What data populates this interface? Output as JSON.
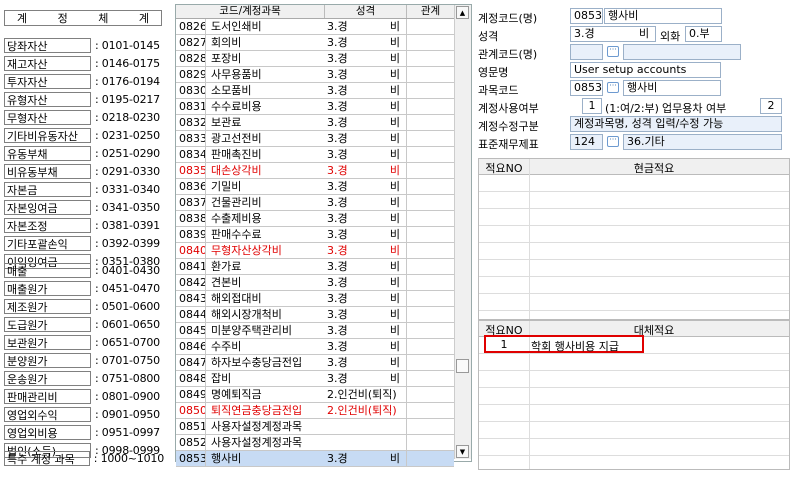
{
  "groups": {
    "header": {
      "col1": "계",
      "col2": "정",
      "col3": "체",
      "col4": "계"
    },
    "items": [
      {
        "name": "당좌자산",
        "range": ": 0101-0145"
      },
      {
        "name": "재고자산",
        "range": ": 0146-0175"
      },
      {
        "name": "투자자산",
        "range": ": 0176-0194"
      },
      {
        "name": "유형자산",
        "range": ": 0195-0217"
      },
      {
        "name": "무형자산",
        "range": ": 0218-0230"
      },
      {
        "name": "기타비유동자산",
        "range": ": 0231-0250"
      },
      {
        "name": "유동부채",
        "range": ": 0251-0290"
      },
      {
        "name": "비유동부채",
        "range": ": 0291-0330"
      },
      {
        "name": "자본금",
        "range": ": 0331-0340"
      },
      {
        "name": "자본잉여금",
        "range": ": 0341-0350"
      },
      {
        "name": "자본조정",
        "range": ": 0381-0391"
      },
      {
        "name": "기타포괄손익",
        "range": ": 0392-0399"
      },
      {
        "name": "이익잉여금",
        "range": ": 0351-0380"
      },
      {
        "name": "매출",
        "range": ": 0401-0430"
      },
      {
        "name": "매출원가",
        "range": ": 0451-0470"
      },
      {
        "name": "제조원가",
        "range": ": 0501-0600"
      },
      {
        "name": "도급원가",
        "range": ": 0601-0650"
      },
      {
        "name": "보관원가",
        "range": ": 0651-0700"
      },
      {
        "name": "분양원가",
        "range": ": 0701-0750"
      },
      {
        "name": "운송원가",
        "range": ": 0751-0800"
      },
      {
        "name": "판매관리비",
        "range": ": 0801-0900"
      },
      {
        "name": "영업외수익",
        "range": ": 0901-0950"
      },
      {
        "name": "영업외비용",
        "range": ": 0951-0997"
      },
      {
        "name": "법인(소득)",
        "range": ": 0998-0999"
      },
      {
        "name": "특수 계정 과목",
        "range": ": 1000~1010"
      }
    ]
  },
  "account_grid": {
    "headers": {
      "code_name": "코드/계정과목",
      "type": "성격",
      "relation": "관계"
    },
    "rows": [
      {
        "code": "0826",
        "name": "도서인쇄비",
        "type": "3.경",
        "type2": "비",
        "red": false,
        "selected": false
      },
      {
        "code": "0827",
        "name": "회의비",
        "type": "3.경",
        "type2": "비",
        "red": false,
        "selected": false
      },
      {
        "code": "0828",
        "name": "포장비",
        "type": "3.경",
        "type2": "비",
        "red": false,
        "selected": false
      },
      {
        "code": "0829",
        "name": "사무용품비",
        "type": "3.경",
        "type2": "비",
        "red": false,
        "selected": false
      },
      {
        "code": "0830",
        "name": "소모품비",
        "type": "3.경",
        "type2": "비",
        "red": false,
        "selected": false
      },
      {
        "code": "0831",
        "name": "수수료비용",
        "type": "3.경",
        "type2": "비",
        "red": false,
        "selected": false
      },
      {
        "code": "0832",
        "name": "보관료",
        "type": "3.경",
        "type2": "비",
        "red": false,
        "selected": false
      },
      {
        "code": "0833",
        "name": "광고선전비",
        "type": "3.경",
        "type2": "비",
        "red": false,
        "selected": false
      },
      {
        "code": "0834",
        "name": "판매촉진비",
        "type": "3.경",
        "type2": "비",
        "red": false,
        "selected": false
      },
      {
        "code": "0835",
        "name": "대손상각비",
        "type": "3.경",
        "type2": "비",
        "red": true,
        "selected": false
      },
      {
        "code": "0836",
        "name": "기밀비",
        "type": "3.경",
        "type2": "비",
        "red": false,
        "selected": false
      },
      {
        "code": "0837",
        "name": "건물관리비",
        "type": "3.경",
        "type2": "비",
        "red": false,
        "selected": false
      },
      {
        "code": "0838",
        "name": "수출제비용",
        "type": "3.경",
        "type2": "비",
        "red": false,
        "selected": false
      },
      {
        "code": "0839",
        "name": "판매수수료",
        "type": "3.경",
        "type2": "비",
        "red": false,
        "selected": false
      },
      {
        "code": "0840",
        "name": "무형자산상각비",
        "type": "3.경",
        "type2": "비",
        "red": true,
        "selected": false
      },
      {
        "code": "0841",
        "name": "환가료",
        "type": "3.경",
        "type2": "비",
        "red": false,
        "selected": false
      },
      {
        "code": "0842",
        "name": "견본비",
        "type": "3.경",
        "type2": "비",
        "red": false,
        "selected": false
      },
      {
        "code": "0843",
        "name": "해외접대비",
        "type": "3.경",
        "type2": "비",
        "red": false,
        "selected": false
      },
      {
        "code": "0844",
        "name": "해외시장개척비",
        "type": "3.경",
        "type2": "비",
        "red": false,
        "selected": false
      },
      {
        "code": "0845",
        "name": "미분양주택관리비",
        "type": "3.경",
        "type2": "비",
        "red": false,
        "selected": false
      },
      {
        "code": "0846",
        "name": "수주비",
        "type": "3.경",
        "type2": "비",
        "red": false,
        "selected": false
      },
      {
        "code": "0847",
        "name": "하자보수충당금전입",
        "type": "3.경",
        "type2": "비",
        "red": false,
        "selected": false
      },
      {
        "code": "0848",
        "name": "잡비",
        "type": "3.경",
        "type2": "비",
        "red": false,
        "selected": false
      },
      {
        "code": "0849",
        "name": "명예퇴직금",
        "type": "2.인건비(퇴직)",
        "type2": "",
        "red": false,
        "selected": false
      },
      {
        "code": "0850",
        "name": "퇴직연금충당금전입",
        "type": "2.인건비(퇴직)",
        "type2": "",
        "red": true,
        "selected": false
      },
      {
        "code": "0851",
        "name": "사용자설정계정과목",
        "type": "",
        "type2": "",
        "red": false,
        "selected": false
      },
      {
        "code": "0852",
        "name": "사용자설정계정과목",
        "type": "",
        "type2": "",
        "red": false,
        "selected": false
      },
      {
        "code": "0853",
        "name": "행사비",
        "type": "3.경",
        "type2": "비",
        "red": false,
        "selected": true
      }
    ]
  },
  "detail": {
    "account_code_label": "계정코드(명)",
    "account_code": "0853",
    "account_name": "행사비",
    "type_label": "성격",
    "type_value": "3.경",
    "type_value2": "비",
    "foreign_label": "외화",
    "foreign_value": "0.부",
    "relation_label": "관계코드(명)",
    "english_label": "영문명",
    "english_value": "User setup accounts",
    "subject_code_label": "과목코드",
    "subject_code": "0853",
    "subject_name": "행사비",
    "usage_label": "계정사용여부",
    "usage_value": "1",
    "usage_hint": "(1:여/2:부)",
    "business_car_label": "업무용차 여부",
    "business_car_value": "2",
    "edit_label": "계정수정구분",
    "edit_value": "계정과목명, 성격 입력/수정 가능",
    "std_fin_label": "표준재무제표",
    "std_fin_code": "124",
    "std_fin_name": "36.기타"
  },
  "cash_grid": {
    "col_no": "적요NO",
    "col_desc": "현금적요"
  },
  "transfer_grid": {
    "col_no": "적요NO",
    "col_desc": "대체적요",
    "rows": [
      {
        "no": "1",
        "desc": "학회 행사비용 지급"
      }
    ]
  },
  "colors": {
    "red_text": "#e00000",
    "selected_row": "#c7dbf4",
    "field_border": "#9bb0c8",
    "highlight_box": "#e00000"
  }
}
